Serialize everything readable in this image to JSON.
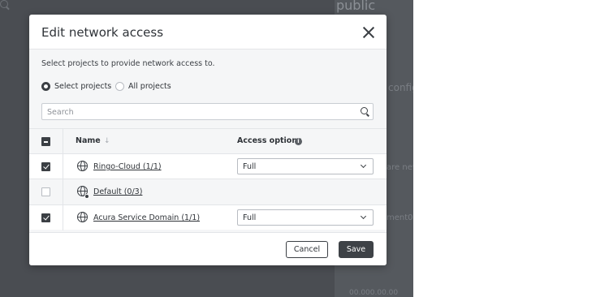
{
  "background": {
    "title": "public",
    "fragments": [
      "configu",
      "are new",
      "ment0",
      "00.000.00.00"
    ]
  },
  "modal": {
    "title": "Edit network access",
    "description": "Select projects to provide network access to.",
    "radios": [
      {
        "label": "Select projects",
        "selected": true
      },
      {
        "label": "All projects",
        "selected": false
      }
    ],
    "search": {
      "placeholder": "Search",
      "value": ""
    },
    "table": {
      "columns": {
        "name": "Name",
        "sort_glyph": "↓",
        "access": "Access options",
        "info_glyph": "i"
      },
      "header_checkbox": "mixed",
      "rows": [
        {
          "name": "Ringo-Cloud (1/1)",
          "checked": true,
          "access": "Full",
          "icon": "globe-icon",
          "has_select": true
        },
        {
          "name": "Default (0/3)",
          "checked": false,
          "access": "",
          "icon": "globe-badge-icon",
          "has_select": false
        },
        {
          "name": "Acura Service Domain (1/1)",
          "checked": true,
          "access": "Full",
          "icon": "globe-icon",
          "has_select": true
        }
      ]
    },
    "buttons": {
      "cancel": "Cancel",
      "save": "Save"
    }
  },
  "colors": {
    "overlay": "#4a4d52",
    "primary": "#3e4247",
    "surface": "#f5f6f7"
  }
}
